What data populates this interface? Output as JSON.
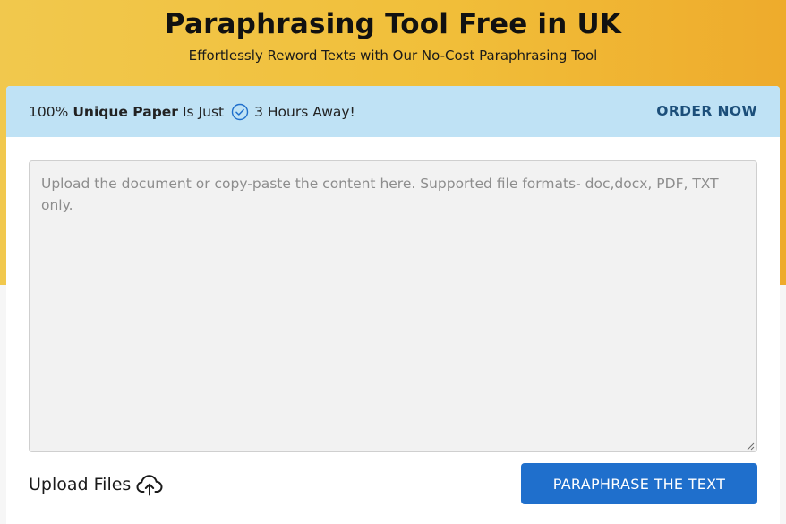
{
  "header": {
    "title": "Paraphrasing Tool Free in UK",
    "subtitle": "Effortlessly Reword Texts with Our No-Cost Paraphrasing Tool"
  },
  "banner": {
    "prefix": "100%",
    "bold": "Unique Paper",
    "middle": "Is Just",
    "icon": "check-circle-icon",
    "suffix": "3 Hours Away!",
    "order_label": "ORDER NOW"
  },
  "editor": {
    "placeholder": "Upload the document or copy-paste the content here. Supported file formats- doc,docx, PDF, TXT only.",
    "value": ""
  },
  "upload": {
    "label": "Upload Files",
    "icon": "cloud-upload-icon"
  },
  "actions": {
    "paraphrase_label": "PARAPHRASE THE TEXT"
  },
  "colors": {
    "hero_gradient_start": "#f1c84d",
    "hero_gradient_end": "#eeab2c",
    "banner_bg": "#bfe2f5",
    "order_text": "#1c4f7a",
    "accent_blue": "#1f6fcc",
    "check_icon": "#1f6fcc"
  }
}
